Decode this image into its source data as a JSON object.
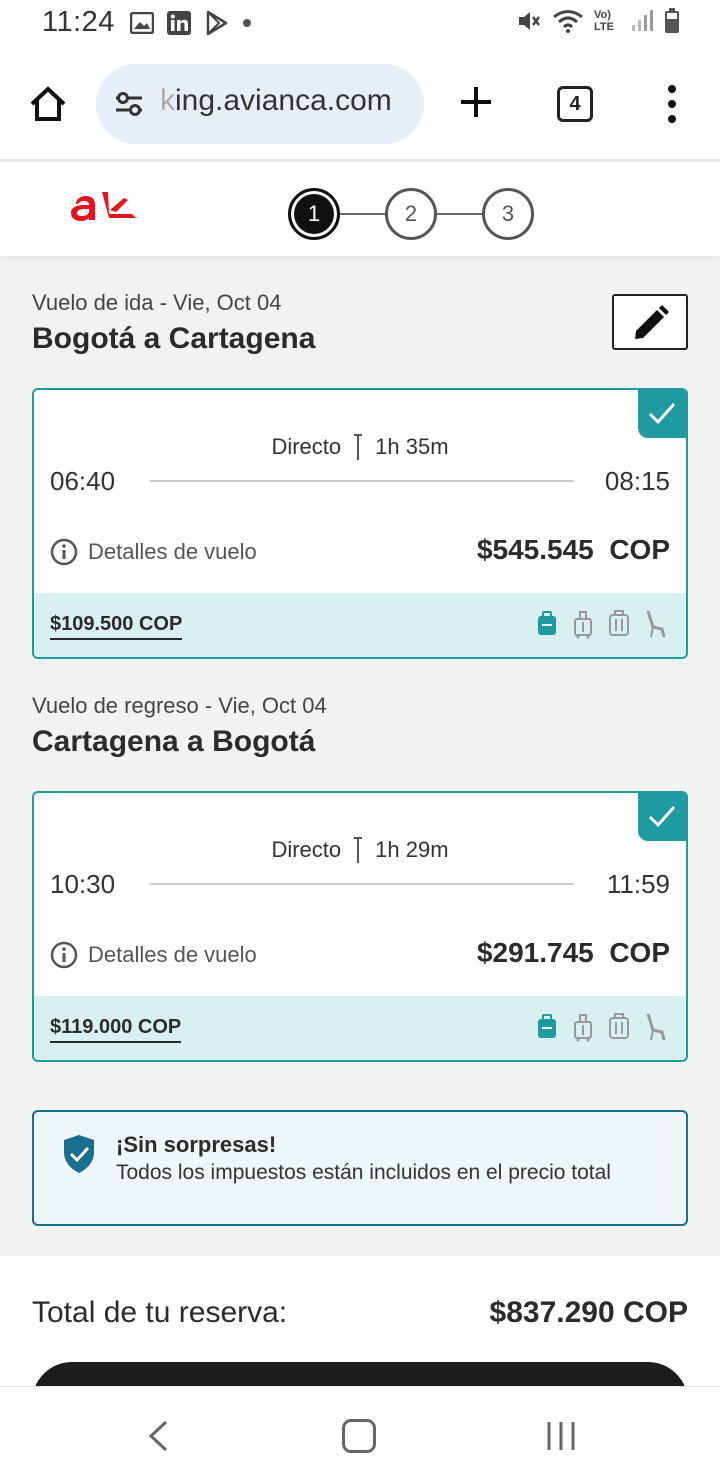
{
  "status_bar": {
    "time": "11:24",
    "icons_left": [
      "gallery-icon",
      "linkedin-icon",
      "play-store-icon",
      "dot-icon"
    ],
    "icons_right": [
      "mute-icon",
      "wifi-icon",
      "volte-icon",
      "signal-icon",
      "battery-icon"
    ],
    "volte_label": "Vo) LTE"
  },
  "browser": {
    "url_prefix": "k",
    "url": "ing.avianca.com",
    "tab_count": "4"
  },
  "stepper": {
    "steps": [
      "1",
      "2",
      "3"
    ],
    "active_step": "1"
  },
  "outbound": {
    "subtitle": "Vuelo de ida - Vie, Oct 04",
    "title": "Bogotá a Cartagena",
    "type": "Directo",
    "duration": "1h 35m",
    "departure": "06:40",
    "arrival": "08:15",
    "details_label": "Detalles de vuelo",
    "price": "$545.545",
    "currency": "COP",
    "footer_price": "$109.500 COP"
  },
  "return": {
    "subtitle": "Vuelo de regreso - Vie, Oct 04",
    "title": "Cartagena a Bogotá",
    "type": "Directo",
    "duration": "1h 29m",
    "departure": "10:30",
    "arrival": "11:59",
    "details_label": "Detalles de vuelo",
    "price": "$291.745",
    "currency": "COP",
    "footer_price": "$119.000 COP"
  },
  "info": {
    "title": "¡Sin sorpresas!",
    "text": "Todos los impuestos están incluidos en el precio total"
  },
  "total": {
    "label": "Total de tu reserva:",
    "value": "$837.290 COP"
  },
  "colors": {
    "accent_teal": "#1e9aa0",
    "card_footer_bg": "#d8f1f0",
    "brand_red": "#e3141f",
    "info_border": "#1a6e8f"
  }
}
